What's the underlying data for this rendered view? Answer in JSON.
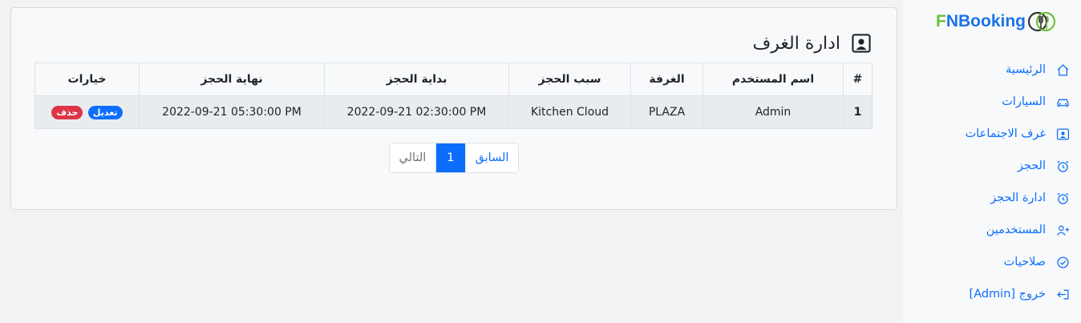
{
  "brand": {
    "first": "F",
    "rest": "NBooking"
  },
  "sidebar": {
    "items": [
      {
        "label": "الرئيسية",
        "icon": "home-icon"
      },
      {
        "label": "السيارات",
        "icon": "car-icon"
      },
      {
        "label": "غرف الاجتماعات",
        "icon": "person-square-icon"
      },
      {
        "label": "الحجز",
        "icon": "alarm-icon"
      },
      {
        "label": "ادارة الحجز",
        "icon": "alarm-icon"
      },
      {
        "label": "المستخدمين",
        "icon": "person-plus-icon"
      },
      {
        "label": "صلاحيات",
        "icon": "check-circle-icon"
      },
      {
        "label": "خروج [Admin]",
        "icon": "logout-icon"
      }
    ]
  },
  "main": {
    "title": "ادارة الغرف",
    "table": {
      "headers": [
        "#",
        "اسم المستخدم",
        "الغرفة",
        "سبب الحجز",
        "بداية الحجز",
        "نهاية الحجز",
        "خيارات"
      ],
      "rows": [
        {
          "num": "1",
          "user": "Admin",
          "room": "PLAZA",
          "reason": "Kitchen Cloud",
          "start": "2022-09-21 02:30:00 PM",
          "end": "2022-09-21 05:30:00 PM",
          "edit_label": "تعديل",
          "delete_label": "حذف"
        }
      ]
    },
    "pagination": {
      "prev": "السابق",
      "current": "1",
      "next": "التالي"
    }
  },
  "colors": {
    "accent": "#0d6efd",
    "danger": "#dc3545",
    "brand_green": "#6cbf3a"
  }
}
